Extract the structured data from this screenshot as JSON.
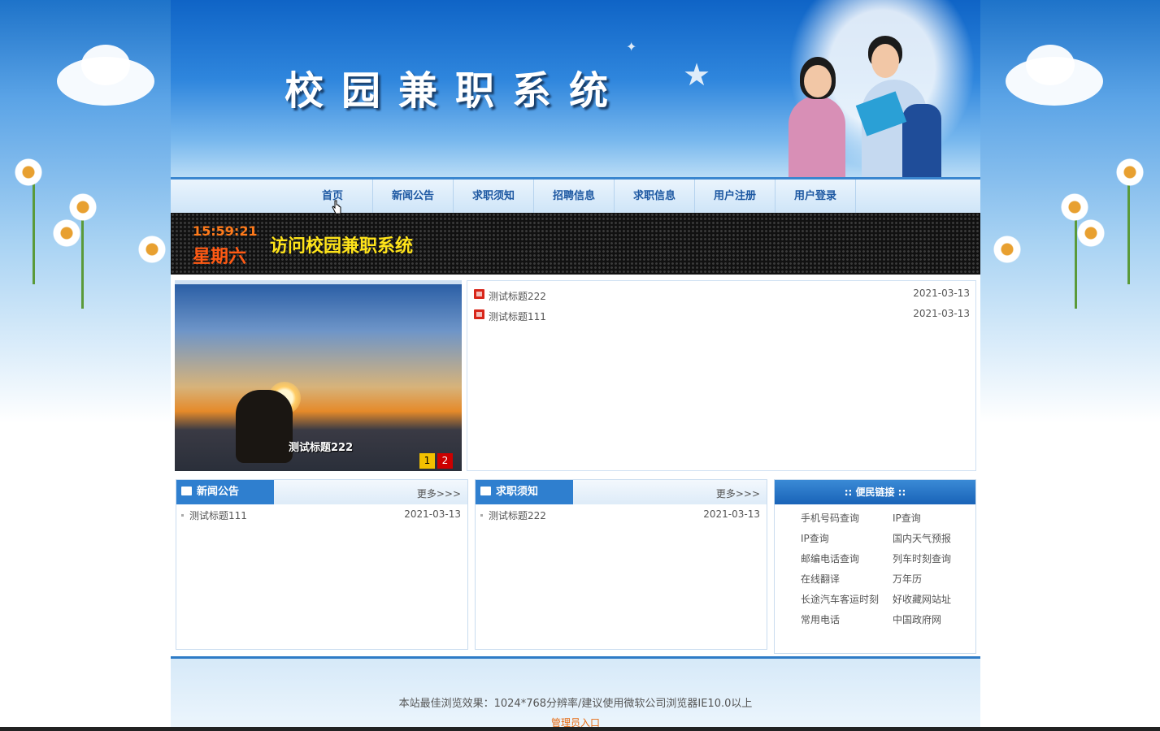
{
  "banner": {
    "site_title": "校园兼职系统"
  },
  "nav": {
    "items": [
      "首页",
      "新闻公告",
      "求职须知",
      "招聘信息",
      "求职信息",
      "用户注册",
      "用户登录"
    ]
  },
  "led": {
    "time": "15:59:21",
    "weekday": "星期六",
    "marquee": "访问校园兼职系统"
  },
  "slideshow": {
    "caption": "测试标题222",
    "pages": [
      "1",
      "2"
    ]
  },
  "top_news": [
    {
      "title": "测试标题222",
      "date": "2021-03-13"
    },
    {
      "title": "测试标题111",
      "date": "2021-03-13"
    }
  ],
  "news_panel": {
    "title": "新闻公告",
    "more": "更多>>>",
    "items": [
      {
        "title": "测试标题111",
        "date": "2021-03-13"
      }
    ]
  },
  "guide_panel": {
    "title": "求职须知",
    "more": "更多>>>",
    "items": [
      {
        "title": "测试标题222",
        "date": "2021-03-13"
      }
    ]
  },
  "links_panel": {
    "title": ":: 便民链接 ::",
    "links": [
      "手机号码查询",
      "IP查询",
      "IP查询",
      "国内天气预报",
      "邮编电话查询",
      "列车时刻查询",
      "在线翻译",
      "万年历",
      "长途汽车客运时刻",
      "好收藏网站址",
      "常用电话",
      "中国政府网"
    ]
  },
  "footer": {
    "note": "本站最佳浏览效果：1024*768分辨率/建议使用微软公司浏览器IE10.0以上",
    "admin_link": "管理员入口"
  },
  "colors": {
    "nav_text": "#1d58a2",
    "led_time": "#ff7a1a",
    "led_marquee": "#ffe41a",
    "admin_link": "#e56a12",
    "panel_tab": "#2f7fcf"
  }
}
